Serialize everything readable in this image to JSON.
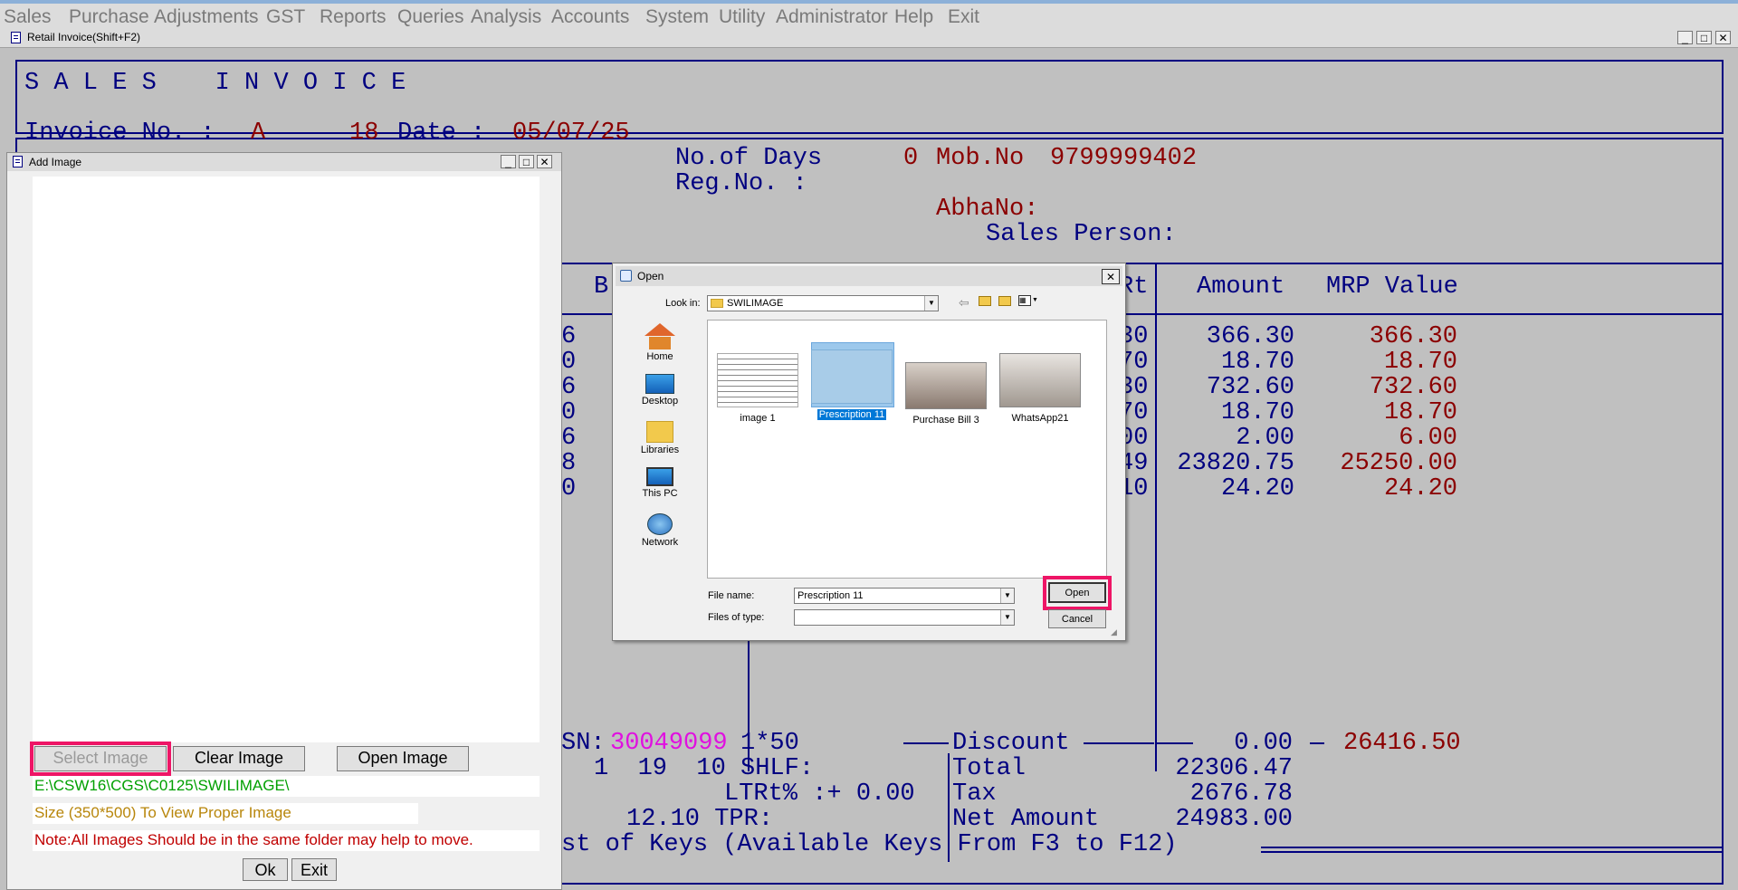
{
  "menu": [
    "Sales",
    "Purchase",
    "Adjustments",
    "GST",
    "Reports",
    "Queries",
    "Analysis",
    "Accounts",
    "System",
    "Utility",
    "Administrator",
    "Help",
    "Exit"
  ],
  "retail_window": {
    "title": "Retail Invoice(Shift+F2)",
    "heading": "S A L E S    I N V O I C E",
    "invoice_label": "Invoice No. :",
    "invoice_series": "A",
    "invoice_number": "18",
    "date_label": "Date :",
    "date_value": "05/07/25",
    "days_label": "No.of Days",
    "days_value": "0",
    "mob_label": "Mob.No",
    "mob_value": "9799999402",
    "reg_label": "Reg.No. :",
    "abha_label": "AbhaNo:",
    "sales_person_label": "Sales Person:",
    "col_b": "B",
    "col_rt": "Rt",
    "col_amount": "Amount",
    "col_mrp": "MRP Value",
    "rows": [
      {
        "left": "6",
        "rt": "30",
        "amount": "366.30",
        "mrp": "366.30"
      },
      {
        "left": "0",
        "rt": "70",
        "amount": "18.70",
        "mrp": "18.70"
      },
      {
        "left": "6",
        "rt": "30",
        "amount": "732.60",
        "mrp": "732.60"
      },
      {
        "left": "0",
        "rt": "70",
        "amount": "18.70",
        "mrp": "18.70"
      },
      {
        "left": "6",
        "rt": "00",
        "amount": "2.00",
        "mrp": "6.00"
      },
      {
        "left": "8",
        "rt": "49",
        "amount": "23820.75",
        "mrp": "25250.00"
      },
      {
        "left": "0",
        "rt": "10",
        "amount": "24.20",
        "mrp": "24.20"
      }
    ],
    "hsn_label": "SN:",
    "hsn_value": "30049099",
    "pack": "1*50",
    "line2": "1  19  10 SHLF:",
    "ltrt": "LTRt% :+ 0.00",
    "tpr": "12.10 TPR:",
    "keys_text": "st of Keys (Available Keys From F3 to F12)",
    "discount_label": "Discount",
    "discount_value": "0.00",
    "mrp_total": "26416.50",
    "total_label": "Total",
    "total_value": "22306.47",
    "tax_label": "Tax",
    "tax_value": "2676.78",
    "net_label": "Net Amount",
    "net_value": "24983.00"
  },
  "add_image": {
    "title": "Add Image",
    "select_label": "Select Image",
    "clear_label": "Clear Image",
    "open_label": "Open Image",
    "path": "E:\\CSW16\\CGS\\C0125\\SWILIMAGE\\",
    "size_note": "Size (350*500) To View Proper Image",
    "note": "Note:All Images Should be in the same folder may help to move.",
    "ok_label": "Ok",
    "exit_label": "Exit"
  },
  "open_dialog": {
    "title": "Open",
    "look_in_label": "Look in:",
    "look_in_value": "SWILIMAGE",
    "places": [
      "Home",
      "Desktop",
      "Libraries",
      "This PC",
      "Network"
    ],
    "files": [
      "image 1",
      "Prescription 11",
      "Purchase Bill 3",
      "WhatsApp21"
    ],
    "selected_file": "Prescription 11",
    "file_name_label": "File name:",
    "file_name_value": "Prescription 11",
    "file_type_label": "Files of type:",
    "file_type_value": "",
    "open_label": "Open",
    "cancel_label": "Cancel"
  },
  "colors": {
    "text_blue": "#000080",
    "text_red": "#8b0000",
    "highlight": "#ee1566",
    "hsn_magenta": "#e010e0",
    "path_green": "#00a000"
  }
}
